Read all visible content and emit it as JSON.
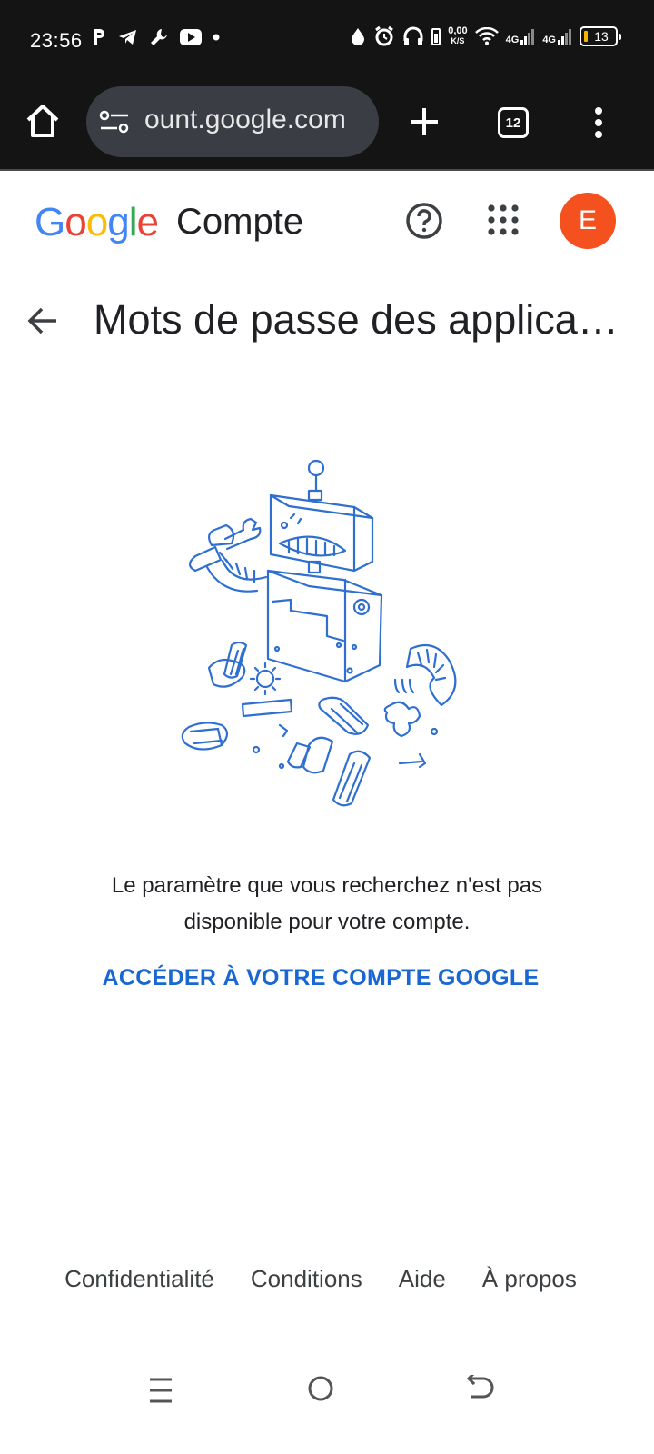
{
  "status_bar": {
    "time": "23:56",
    "net_speed_value": "0,00",
    "net_speed_unit": "K/S",
    "signal_1": "4G",
    "signal_2": "4G",
    "battery_level": "13"
  },
  "browser": {
    "url": "ount.google.com",
    "tab_count": "12"
  },
  "header": {
    "logo_letters": [
      "G",
      "o",
      "o",
      "g",
      "l",
      "e"
    ],
    "logo_colors": [
      "#4285F4",
      "#EA4335",
      "#FBBC05",
      "#4285F4",
      "#34A853",
      "#EA4335"
    ],
    "product": "Compte",
    "avatar_initial": "E",
    "avatar_color": "#F4511E"
  },
  "page": {
    "title": "Mots de passe des applica…",
    "message_line1": "Le paramètre que vous recherchez n'est pas",
    "message_line2": "disponible pour votre compte.",
    "cta": "ACCÉDER À VOTRE COMPTE GOOGLE"
  },
  "footer": {
    "links": [
      "Confidentialité",
      "Conditions",
      "Aide",
      "À propos"
    ]
  },
  "icons": {
    "illustration": "broken-robot-illustration"
  }
}
